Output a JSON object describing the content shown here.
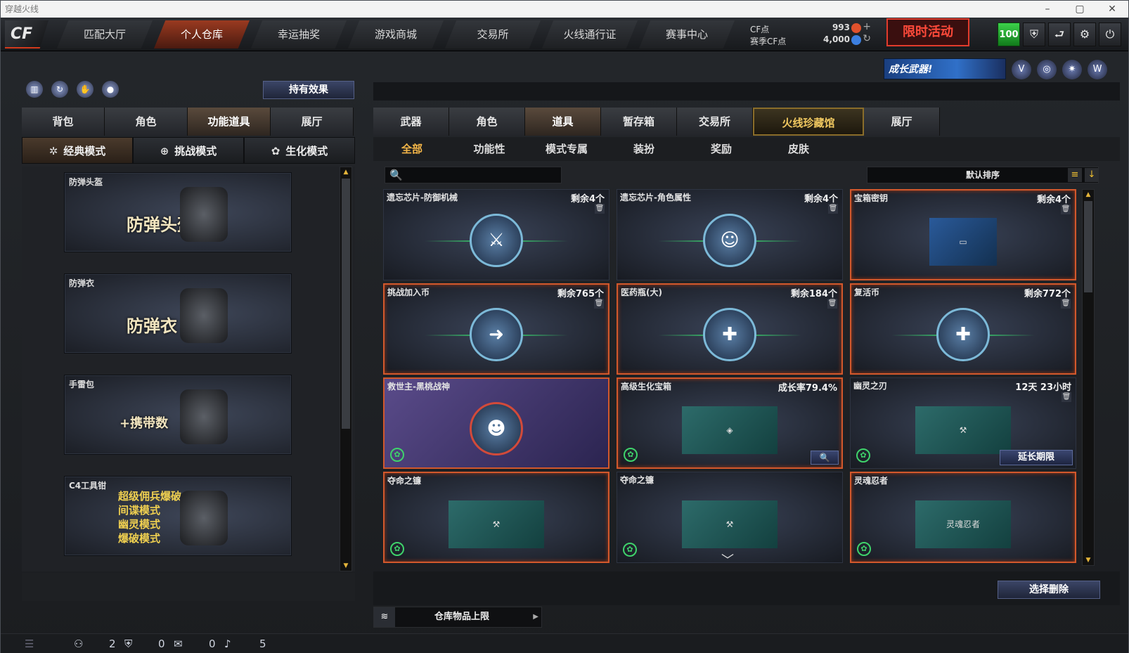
{
  "window": {
    "title": "穿越火线",
    "buttons": [
      "–",
      "▢",
      "✕"
    ]
  },
  "nav": [
    "匹配大厅",
    "个人仓库",
    "幸运抽奖",
    "游戏商城",
    "交易所",
    "火线通行证",
    "赛事中心"
  ],
  "nav_active": 1,
  "currency": {
    "cf_label": "CF点",
    "cf_value": "993",
    "season_label": "赛季CF点",
    "season_value": "4,000"
  },
  "red_box": "限时活动",
  "header_icons": {
    "level": "100",
    "icons": [
      "shield-icon",
      "back-icon",
      "gear-icon",
      "power-icon"
    ]
  },
  "banner": "成长武器!",
  "left": {
    "hold_effect": "持有效果",
    "tabs": [
      "背包",
      "角色",
      "功能道具",
      "展厅"
    ],
    "active_tab": 2,
    "modes": [
      "经典模式",
      "挑战模式",
      "生化模式"
    ],
    "items": [
      {
        "name": "防弹头盔",
        "caption": "防弹头盔"
      },
      {
        "name": "防弹衣",
        "caption": "防弹衣"
      },
      {
        "name": "手雷包",
        "caption": "+携带数"
      },
      {
        "name": "C4工具钳",
        "lines": [
          "超级佣兵爆破",
          "间谍模式",
          "幽灵模式",
          "爆破模式"
        ]
      }
    ]
  },
  "right": {
    "tabs": [
      "武器",
      "角色",
      "道具",
      "暂存箱",
      "交易所",
      "火线珍藏馆",
      "展厅"
    ],
    "active_tab": 2,
    "gold_tab": 5,
    "subtabs": [
      "全部",
      "功能性",
      "模式专属",
      "装扮",
      "奖励",
      "皮肤"
    ],
    "active_sub": 0,
    "sort": "默认排序",
    "delete_btn": "选择删除",
    "storage": "仓库物品上限",
    "cards": [
      {
        "name": "遗忘芯片-防御机械",
        "right": "剩余4个",
        "style": "emblem",
        "sel": false,
        "glyph": "⚔"
      },
      {
        "name": "遗忘芯片-角色属性",
        "right": "剩余4个",
        "style": "emblem",
        "sel": false,
        "glyph": "☺"
      },
      {
        "name": "宝箱密钥",
        "right": "剩余4个",
        "style": "key",
        "sel": true,
        "glyph": "▭"
      },
      {
        "name": "挑战加入币",
        "right": "剩余765个",
        "style": "emblem",
        "sel": true,
        "glyph": "➜"
      },
      {
        "name": "医药瓶(大)",
        "right": "剩余184个",
        "style": "emblem",
        "sel": true,
        "glyph": "✚"
      },
      {
        "name": "复活币",
        "right": "剩余772个",
        "style": "emblem",
        "sel": true,
        "glyph": "✚"
      },
      {
        "name": "救世主-黑桃战神",
        "right": "",
        "style": "char",
        "sel": true,
        "glyph": "☻"
      },
      {
        "name": "高级生化宝箱",
        "right": "成长率79.4%",
        "style": "thumb",
        "sel": true,
        "glyph": "◈"
      },
      {
        "name": "幽灵之刃",
        "right": "12天 23小时",
        "style": "thumb",
        "sel": false,
        "glyph": "⚒",
        "extend": "延长期限"
      },
      {
        "name": "夺命之镰",
        "right": "",
        "style": "thumb",
        "sel": true,
        "glyph": "⚒"
      },
      {
        "name": "夺命之镰",
        "right": "",
        "style": "thumb",
        "sel": false,
        "glyph": "⚒"
      },
      {
        "name": "灵魂忍者",
        "right": "",
        "style": "thumb",
        "sel": true,
        "glyph": "灵魂忍者"
      }
    ]
  },
  "status": {
    "a": "2",
    "b": "0",
    "c": "0",
    "d": "5"
  }
}
